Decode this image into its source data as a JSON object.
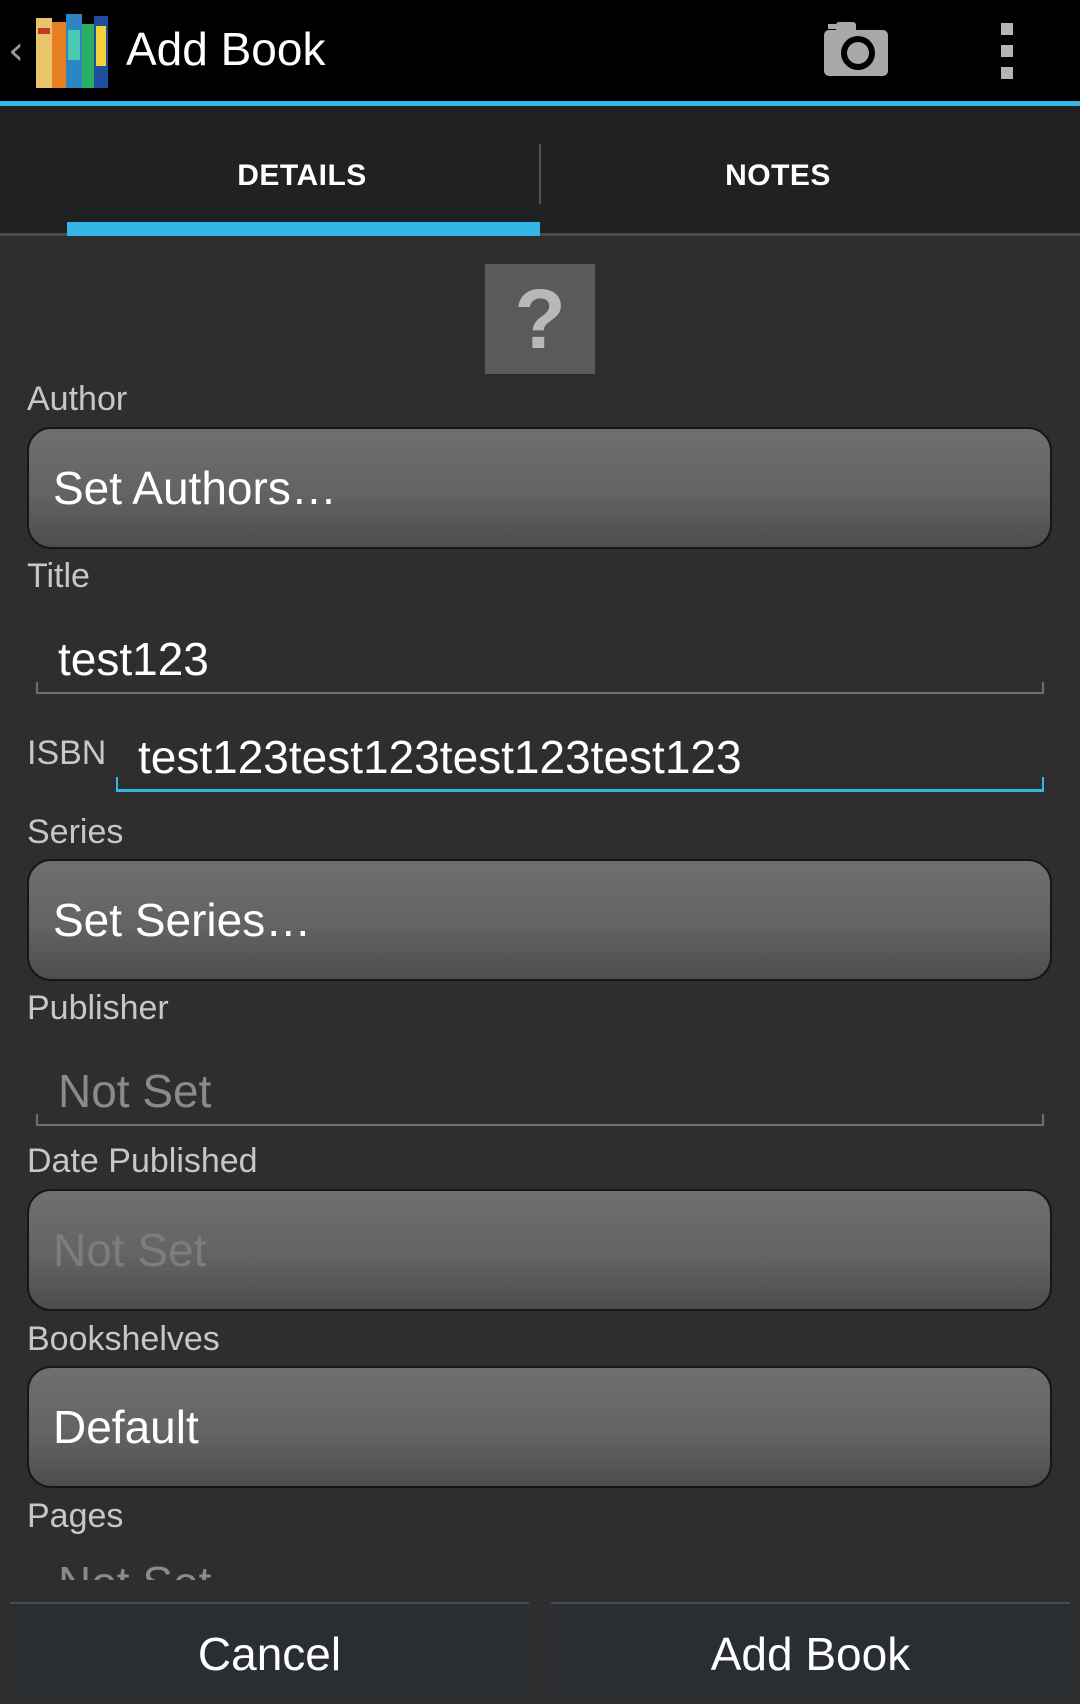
{
  "actionbar": {
    "title": "Add Book",
    "back_icon": "chevron-left-icon",
    "app_icon": "books-icon",
    "camera_icon": "camera-icon",
    "overflow_icon": "overflow-menu-icon"
  },
  "tabs": [
    {
      "label": "DETAILS",
      "selected": true
    },
    {
      "label": "NOTES",
      "selected": false
    }
  ],
  "cover": {
    "glyph": "?"
  },
  "form": {
    "author_label": "Author",
    "author_value": "Set Authors…",
    "title_label": "Title",
    "title_value": "test123",
    "isbn_label": "ISBN",
    "isbn_value": "test123test123test123test123",
    "series_label": "Series",
    "series_value": "Set Series…",
    "publisher_label": "Publisher",
    "publisher_hint": "Not Set",
    "date_label": "Date Published",
    "date_hint": "Not Set",
    "bookshelves_label": "Bookshelves",
    "bookshelves_value": "Default",
    "pages_label": "Pages",
    "pages_hint": "Not Set"
  },
  "buttons": {
    "cancel": "Cancel",
    "add": "Add Book"
  },
  "colors": {
    "accent": "#33b5e5",
    "background": "#2e2e2f",
    "actionbar": "#000000"
  }
}
